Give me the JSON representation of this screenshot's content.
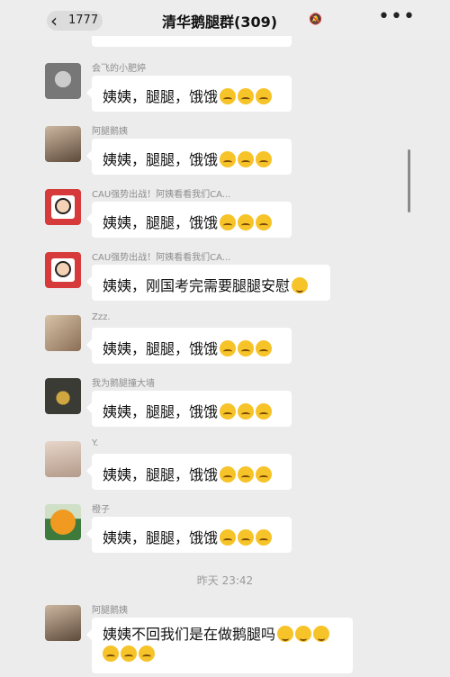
{
  "header": {
    "back_count": "1777",
    "title": "清华鹅腿群(309)",
    "more": "•••"
  },
  "messages": [
    {
      "sender": "会飞的小肥婷",
      "text": "姨姨，腿腿，饿饿",
      "emoji": [
        "angry",
        "angry",
        "angry"
      ]
    },
    {
      "sender": "阿腿鹅姨",
      "text": "姨姨，腿腿，饿饿",
      "emoji": [
        "angry",
        "angry",
        "angry"
      ]
    },
    {
      "sender": "CAU强势出战！阿姨看看我们CA...",
      "text": "姨姨，腿腿，饿饿",
      "emoji": [
        "angry",
        "angry",
        "angry"
      ]
    },
    {
      "sender": "CAU强势出战！阿姨看看我们CA...",
      "text": "姨姨，刚国考完需要腿腿安慰",
      "emoji": [
        "sob"
      ]
    },
    {
      "sender": "Zzz.",
      "text": "姨姨，腿腿，饿饿",
      "emoji": [
        "angry",
        "angry",
        "angry"
      ]
    },
    {
      "sender": "我为鹅腿撞大墙",
      "text": "姨姨，腿腿，饿饿",
      "emoji": [
        "angry",
        "angry",
        "angry"
      ]
    },
    {
      "sender": "Y.",
      "text": "姨姨，腿腿，饿饿",
      "emoji": [
        "angry",
        "angry",
        "angry"
      ]
    },
    {
      "sender": "橙子",
      "text": "姨姨，腿腿，饿饿",
      "emoji": [
        "angry",
        "angry",
        "angry"
      ]
    }
  ],
  "timestamp": "昨天 23:42",
  "last_message": {
    "sender": "阿腿鹅姨",
    "line1": "姨姨不回我们是在做鹅腿吗",
    "line1_emoji": [
      "sad",
      "sad",
      "sad"
    ],
    "line2_emoji": [
      "angry",
      "angry",
      "angry"
    ]
  }
}
